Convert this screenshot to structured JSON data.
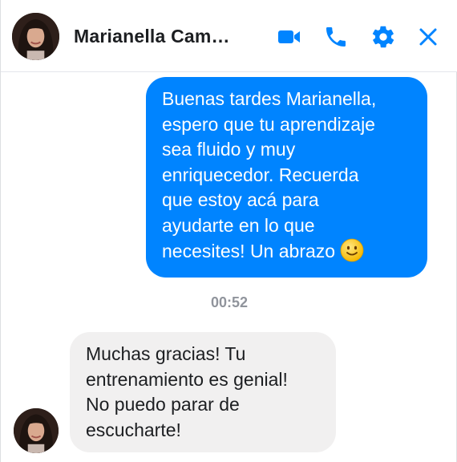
{
  "header": {
    "contact_name": "Marianella Cam…",
    "icons": {
      "video": "video-camera-icon",
      "call": "phone-icon",
      "settings": "gear-icon",
      "close": "close-icon"
    }
  },
  "conversation": {
    "outgoing_message": {
      "lines": [
        "Buenas tardes Marianella,",
        "espero que tu aprendizaje",
        "sea fluido y muy",
        "enriquecedor. Recuerda",
        "que estoy acá para",
        "ayudarte en lo que",
        "necesites! Un abrazo"
      ],
      "emoji": "slightly-smiling-face-icon"
    },
    "timestamp": "00:52",
    "incoming_message": {
      "lines": [
        "Muchas gracias! Tu",
        "entrenamiento es genial!",
        "No puedo parar de",
        "escucharte!"
      ]
    }
  },
  "colors": {
    "accent": "#0084ff",
    "outgoing_bubble": "#0084ff",
    "incoming_bubble": "#f1f0f0",
    "timestamp_text": "#90949c"
  }
}
